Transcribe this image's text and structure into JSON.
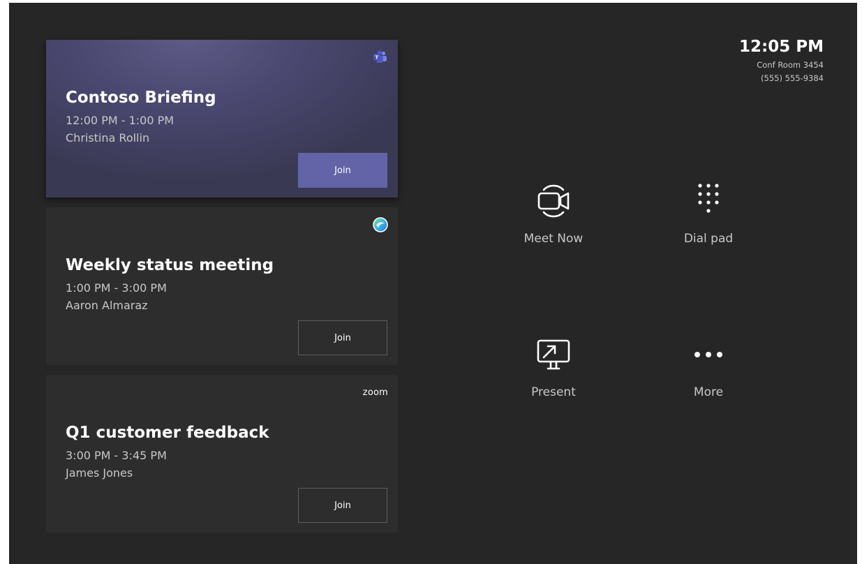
{
  "header": {
    "time": "12:05 PM",
    "room_name": "Conf Room 3454",
    "room_phone": "(555) 555-9384"
  },
  "meetings": [
    {
      "title": "Contoso Briefing",
      "time": "12:00 PM - 1:00 PM",
      "organizer": "Christina Rollin",
      "join_label": "Join",
      "provider_icon": "teams-icon"
    },
    {
      "title": "Weekly status meeting",
      "time": "1:00 PM - 3:00 PM",
      "organizer": "Aaron Almaraz",
      "join_label": "Join",
      "provider_icon": "webex-icon"
    },
    {
      "title": "Q1 customer feedback",
      "time": "3:00 PM - 3:45 PM",
      "organizer": "James Jones",
      "join_label": "Join",
      "provider_icon": "zoom-logo",
      "provider_text": "zoom"
    }
  ],
  "actions": [
    {
      "label": "Meet Now",
      "icon": "video-camera-icon"
    },
    {
      "label": "Dial pad",
      "icon": "dial-pad-icon"
    },
    {
      "label": "Present",
      "icon": "present-screen-icon"
    },
    {
      "label": "More",
      "icon": "more-dots-icon"
    }
  ],
  "colors": {
    "background": "#262626",
    "card": "#2d2d2d",
    "active_card": "#4a4870",
    "join_primary": "#6264a7",
    "text_primary": "#ffffff",
    "text_secondary": "#c8c8c8"
  }
}
